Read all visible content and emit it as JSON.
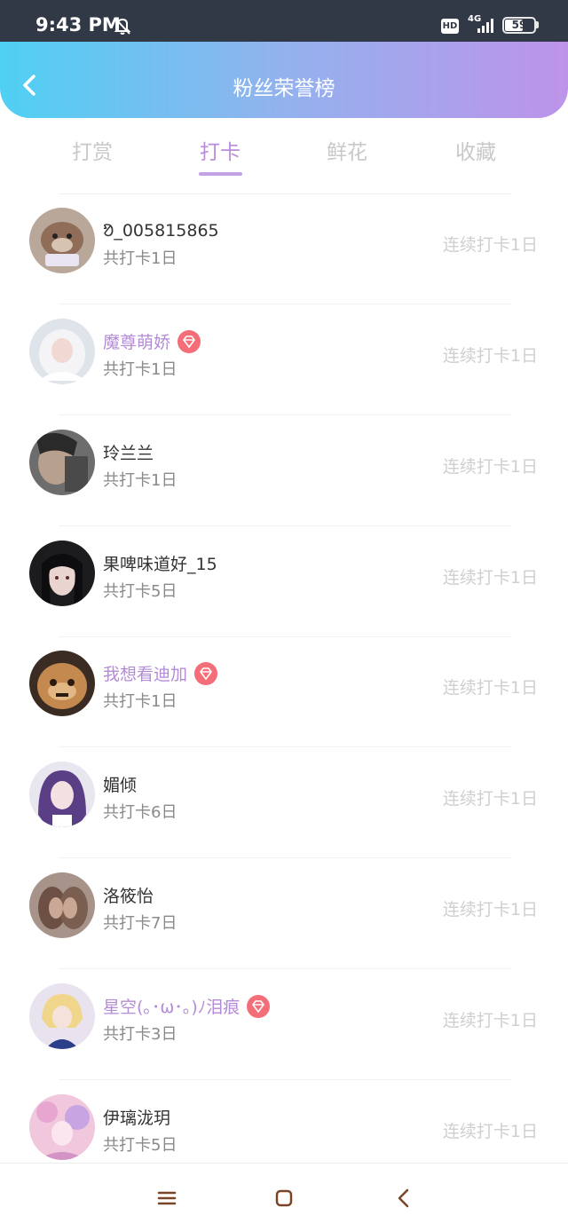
{
  "status": {
    "time": "9:43 PM",
    "hd": "HD",
    "network": "4G",
    "battery": "59"
  },
  "header": {
    "title": "粉丝荣誉榜"
  },
  "tabs": [
    {
      "label": "打赏"
    },
    {
      "label": "打卡"
    },
    {
      "label": "鲜花"
    },
    {
      "label": "收藏"
    }
  ],
  "active_tab": "打卡",
  "list": [
    {
      "name": "ᱚ_005815865",
      "total": "共打卡1日",
      "streak": "连续打卡1日",
      "vip": false
    },
    {
      "name": "魔尊萌娇",
      "total": "共打卡1日",
      "streak": "连续打卡1日",
      "vip": true
    },
    {
      "name": "玲兰兰",
      "total": "共打卡1日",
      "streak": "连续打卡1日",
      "vip": false
    },
    {
      "name": "果啤味道好_15",
      "total": "共打卡5日",
      "streak": "连续打卡1日",
      "vip": false
    },
    {
      "name": "我想看迪加",
      "total": "共打卡1日",
      "streak": "连续打卡1日",
      "vip": true
    },
    {
      "name": "媚倾",
      "total": "共打卡6日",
      "streak": "连续打卡1日",
      "vip": false
    },
    {
      "name": "洛筱怡",
      "total": "共打卡7日",
      "streak": "连续打卡1日",
      "vip": false
    },
    {
      "name": "星空(｡･ω･｡)ﾉ泪痕",
      "total": "共打卡3日",
      "streak": "连续打卡1日",
      "vip": true
    },
    {
      "name": "伊璃泷玥",
      "total": "共打卡5日",
      "streak": "连续打卡1日",
      "vip": false
    }
  ],
  "colors": {
    "accent": "#b98ddc",
    "vip_name": "#b48bd6",
    "badge": "#f46e79",
    "header_start": "#4fd0f3",
    "header_end": "#bd93ea"
  },
  "icons": {
    "back": "back-arrow-icon",
    "vip": "diamond-icon",
    "nav_menu": "menu-icon",
    "nav_home": "home-square-icon",
    "nav_back": "back-triangle-icon"
  }
}
